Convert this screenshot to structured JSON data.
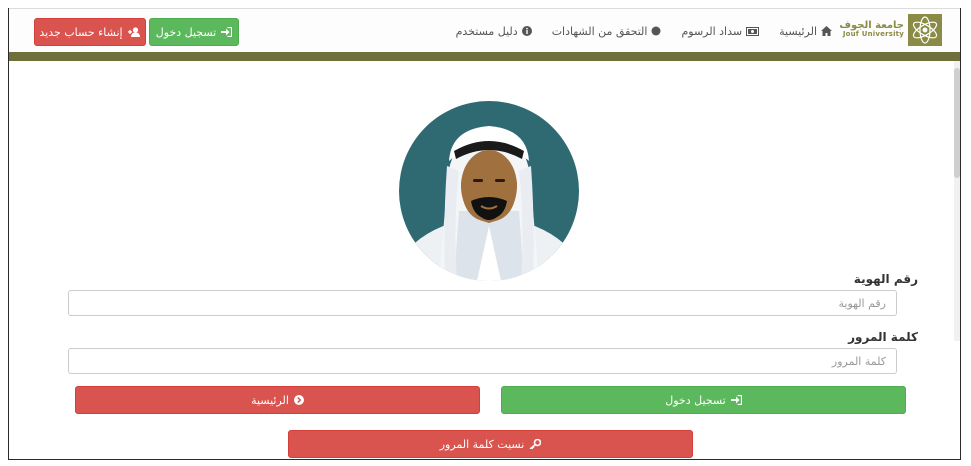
{
  "header": {
    "logo": {
      "arabic": "جامعة الجوف",
      "english": "Jouf University"
    },
    "nav": [
      {
        "label": "الرئيسية",
        "icon": "home-icon"
      },
      {
        "label": "سداد الرسوم",
        "icon": "money-icon"
      },
      {
        "label": "التحقق من الشهادات",
        "icon": "globe-icon"
      },
      {
        "label": "دليل مستخدم",
        "icon": "info-icon"
      }
    ],
    "login_button": "تسجيل دخول",
    "register_button": "إنشاء حساب جديد"
  },
  "form": {
    "id_label": "رقم الهوية",
    "id_placeholder": "رقم الهوية",
    "password_label": "كلمة المرور",
    "password_placeholder": "كلمة المرور",
    "login_button": "تسجيل دخول",
    "home_button": "الرئيسية",
    "forgot_button": "نسيت كلمة المرور"
  },
  "colors": {
    "olive": "#6e6f3b",
    "green": "#5cb85c",
    "red": "#d9534f",
    "avatar_bg": "#2f6a73"
  }
}
